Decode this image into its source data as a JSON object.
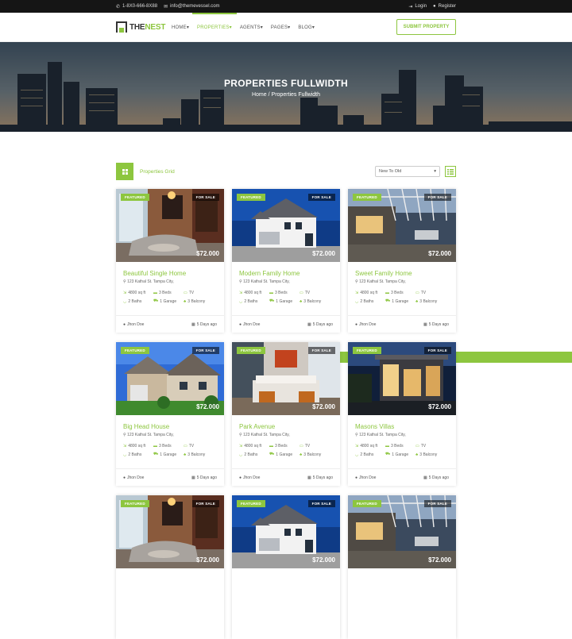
{
  "topbar": {
    "phone": "1-8X0-666-8X88",
    "email": "info@themevessel.com",
    "login": "Login",
    "register": "Register"
  },
  "nav": {
    "logo_a": "THE",
    "logo_b": "NEST",
    "items": [
      {
        "label": "HOME",
        "suffix": "▾"
      },
      {
        "label": "PROPERTIES",
        "suffix": "▾"
      },
      {
        "label": "AGENTS",
        "suffix": "▾"
      },
      {
        "label": "PAGES",
        "suffix": "▾"
      },
      {
        "label": "BLOG",
        "suffix": "▾"
      }
    ],
    "active_index": 1,
    "submit": "SUBMIT PROPERTY"
  },
  "hero": {
    "title": "PROPERTIES FULLWIDTH",
    "crumb_home": "Home",
    "crumb_sep": "/",
    "crumb_current": "Properties Fullwidth"
  },
  "toolbar": {
    "label": "Properties Grid",
    "sort_value": "New To Old"
  },
  "colors": {
    "accent": "#8dc63f",
    "topbar": "#151515"
  },
  "cards": [
    {
      "title": "Beautiful Single Home",
      "address": "123 Kathal St. Tampa City,",
      "price": "$72.000",
      "featured": "FEATURED",
      "sale": "FOR SALE",
      "area": "4800 sq ft",
      "beds": "3 Beds",
      "tv": "TV",
      "baths": "2 Baths",
      "garage": "1 Garage",
      "balcony": "3 Balcony",
      "agent": "Jhon Doe",
      "date": "5 Days ago",
      "img": "interior"
    },
    {
      "title": "Modern Family Home",
      "address": "123 Kathal St. Tampa City,",
      "price": "$72.000",
      "featured": "FEATURED",
      "sale": "FOR SALE",
      "area": "4800 sq ft",
      "beds": "3 Beds",
      "tv": "TV",
      "baths": "2 Baths",
      "garage": "1 Garage",
      "balcony": "3 Balcony",
      "agent": "Jhon Doe",
      "date": "5 Days ago",
      "img": "house-white"
    },
    {
      "title": "Sweet Family Home",
      "address": "123 Kathal St. Tampa City,",
      "price": "$72.000",
      "featured": "FEATURED",
      "sale": "FOR SALE",
      "area": "4800 sq ft",
      "beds": "3 Beds",
      "tv": "TV",
      "baths": "2 Baths",
      "garage": "1 Garage",
      "balcony": "3 Balcony",
      "agent": "Jhon Doe",
      "date": "5 Days ago",
      "img": "pergola"
    },
    {
      "title": "Big Head House",
      "address": "123 Kathal St. Tampa City,",
      "price": "$72.000",
      "featured": "FEATURED",
      "sale": "FOR SALE",
      "area": "4800 sq ft",
      "beds": "3 Beds",
      "tv": "TV",
      "baths": "2 Baths",
      "garage": "1 Garage",
      "balcony": "3 Balcony",
      "agent": "Jhon Doe",
      "date": "5 Days ago",
      "img": "suburban"
    },
    {
      "title": "Park Avenue",
      "address": "123 Kathal St. Tampa City,",
      "price": "$72.000",
      "featured": "FEATURED",
      "sale": "FOR SALE",
      "area": "4800 sq ft",
      "beds": "3 Beds",
      "tv": "TV",
      "baths": "2 Baths",
      "garage": "1 Garage",
      "balcony": "3 Balcony",
      "agent": "Jhon Doe",
      "date": "5 Days ago",
      "img": "bedroom"
    },
    {
      "title": "Masons Villas",
      "address": "123 Kathal St. Tampa City,",
      "price": "$72.000",
      "featured": "FEATURED",
      "sale": "FOR SALE",
      "area": "4800 sq ft",
      "beds": "3 Beds",
      "tv": "TV",
      "baths": "2 Baths",
      "garage": "1 Garage",
      "balcony": "3 Balcony",
      "agent": "Jhon Doe",
      "date": "5 Days ago",
      "img": "villa-night"
    },
    {
      "price": "$72.000",
      "featured": "FEATURED",
      "sale": "FOR SALE",
      "img": "interior"
    },
    {
      "price": "$72.000",
      "featured": "FEATURED",
      "sale": "FOR SALE",
      "img": "house-white"
    },
    {
      "price": "$72.000",
      "featured": "FEATURED",
      "sale": "FOR SALE",
      "img": "pergola"
    }
  ]
}
